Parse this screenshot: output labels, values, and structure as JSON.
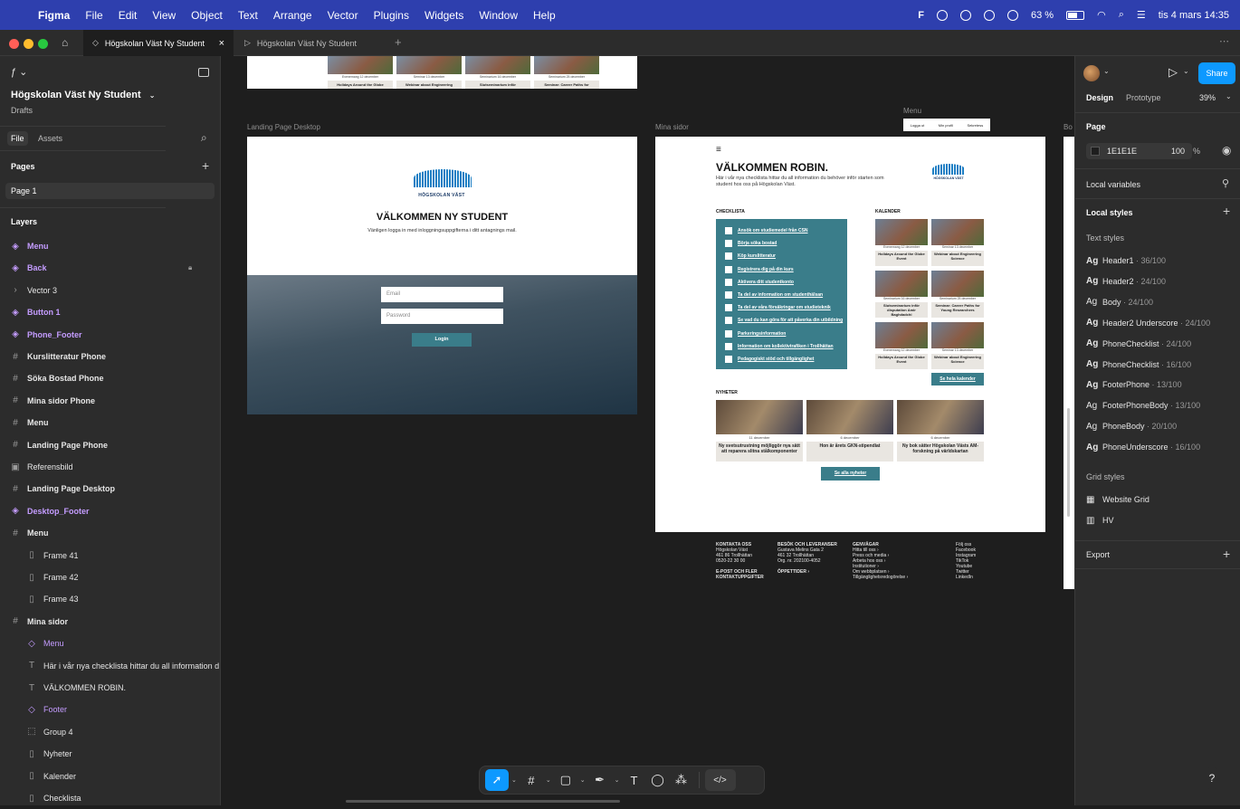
{
  "menubar": {
    "app": "Figma",
    "items": [
      "File",
      "Edit",
      "View",
      "Object",
      "Text",
      "Arrange",
      "Vector",
      "Plugins",
      "Widgets",
      "Window",
      "Help"
    ],
    "battery": "63 %",
    "datetime": "tis 4 mars 14:35"
  },
  "tabs": [
    {
      "label": "Högskolan Väst Ny Student"
    },
    {
      "label": "Högskolan Väst Ny Student"
    }
  ],
  "left": {
    "file_name": "Högskolan Väst Ny Student",
    "location": "Drafts",
    "tab_file": "File",
    "tab_assets": "Assets",
    "pages_title": "Pages",
    "page_current": "Page 1",
    "layers_title": "Layers",
    "layers": [
      {
        "label": "Menu",
        "type": "component"
      },
      {
        "label": "Back",
        "type": "component"
      },
      {
        "label": "Vector 3",
        "type": "vector"
      },
      {
        "label": "Button 1",
        "type": "component"
      },
      {
        "label": "Phone_Footer",
        "type": "component"
      },
      {
        "label": "Kurslitteratur Phone",
        "type": "frame"
      },
      {
        "label": "Söka Bostad Phone",
        "type": "frame"
      },
      {
        "label": "Mina sidor Phone",
        "type": "frame"
      },
      {
        "label": "Menu",
        "type": "frame"
      },
      {
        "label": "Landing Page Phone",
        "type": "frame"
      },
      {
        "label": "Referensbild",
        "type": "image"
      },
      {
        "label": "Landing Page Desktop",
        "type": "frame"
      },
      {
        "label": "Desktop_Footer",
        "type": "component"
      },
      {
        "label": "Menu",
        "type": "frame"
      },
      {
        "label": "Frame 41",
        "type": "child"
      },
      {
        "label": "Frame 42",
        "type": "child"
      },
      {
        "label": "Frame 43",
        "type": "child"
      },
      {
        "label": "Mina sidor",
        "type": "frame"
      },
      {
        "label": "Menu",
        "type": "instance"
      },
      {
        "label": "Här i vår nya checklista hittar du all information d",
        "type": "text"
      },
      {
        "label": "VÄLKOMMEN ROBIN.",
        "type": "text"
      },
      {
        "label": "Footer",
        "type": "instance"
      },
      {
        "label": "Group 4",
        "type": "group"
      },
      {
        "label": "Nyheter",
        "type": "child"
      },
      {
        "label": "Kalender",
        "type": "child"
      },
      {
        "label": "Checklista",
        "type": "child"
      }
    ]
  },
  "canvas": {
    "label_landing": "Landing Page Desktop",
    "label_mina": "Mina sidor",
    "label_menu": "Menu",
    "label_bo": "Bo",
    "top_cards": [
      "Evenemang 12 december",
      "Seminar 13 december",
      "Seminarium 16 december",
      "Seminarium 25 december"
    ],
    "top_card_titles": [
      "Holidays Around the Globe",
      "Webinar about Engineering",
      "Slutseminarium inför",
      "Seminar: Career Paths for"
    ],
    "landing": {
      "school": "HÖGSKOLAN VÄST",
      "title": "VÄLKOMMEN NY STUDENT",
      "subtitle": "Vänligen logga in med inloggningsuppgifterna i ditt antagnings mail.",
      "email_placeholder": "Email",
      "password_placeholder": "Password",
      "login": "Login"
    },
    "menu_pills": [
      "Logga ut",
      "Min profil",
      "Sekretess"
    ],
    "mina": {
      "hamburger": "≡",
      "title": "VÄLKOMMEN ROBIN.",
      "intro": "Här i vår nya checklista hittar du all information du behöver inför starten som student hos oss på Högskolan Väst.",
      "school": "HÖGSKOLAN VÄST",
      "checklist_title": "CHECKLISTA",
      "checklist": [
        "Ansök om studiemedel från CSN",
        "Börja söka bostad",
        "Köp kurslitteratur",
        "Registrera dig på din kurs",
        "Aktivera ditt studentkonto",
        "Ta del av information om studenthälsan",
        "Ta del av våra försäkringar om studieteknik",
        "Se vad du kan göra för att påverka din utbildning",
        "Parkeringsinformation",
        "Information om kollektivtrafiken i Trollhättan",
        "Pedagogiskt stöd och tillgänglighet"
      ],
      "kalender_title": "KALENDER",
      "kalender": [
        {
          "date": "Evenemang 12 december",
          "title": "Holidays Around the Globe Event"
        },
        {
          "date": "Seminar 13 december",
          "title": "Webinar about Engineering Science"
        },
        {
          "date": "Seminarium 16 december",
          "title": "Slutseminarium inför disputation Amir Baghdadchi"
        },
        {
          "date": "Seminarium 25 december",
          "title": "Seminar: Career Paths for Young Researchers"
        },
        {
          "date": "Evenemang 12 december",
          "title": "Holidays Around the Globe Event"
        },
        {
          "date": "Seminar 13 december",
          "title": "Webinar about Engineering Science"
        }
      ],
      "kalender_button": "Se hela kalender",
      "nyheter_title": "NYHETER",
      "nyheter": [
        {
          "date": "11 december",
          "title": "Ny svetsutrustning möjliggör nya sätt att reparera slitna stålkomponenter"
        },
        {
          "date": "6 december",
          "title": "Hon är årets GKN-stipendiat"
        },
        {
          "date": "6 december",
          "title": "Ny bok sätter Högskolan Västs AM-forskning på världskartan"
        }
      ],
      "nyheter_button": "Se alla nyheter"
    },
    "footer": {
      "col1_title": "KONTAKTA OSS",
      "col1_lines": [
        "Högskolan Väst",
        "461 86 Trollhättan",
        "0520-22 30 00"
      ],
      "col1b_title": "E-POST OCH FLER KONTAKTUPPGIFTER",
      "col2_title": "BESÖK OCH LEVERANSER",
      "col2_lines": [
        "Gustava Melins Gata 2",
        "461 32 Trollhättan",
        "Org. nr. 202100-4052"
      ],
      "col2b_title": "ÖPPETTIDER ›",
      "col3_title": "GENVÄGAR",
      "col3_lines": [
        "Hitta till oss ›",
        "Press och media ›",
        "Arbeta hos oss ›",
        "Institutioner ›",
        "Om webbplatsen ›",
        "Tillgänglighetsredogörelse ›"
      ],
      "col4_title": "Följ oss",
      "col4_lines": [
        "Facebook",
        "Instagram",
        "TikTok",
        "Youtube",
        "Twitter",
        "LinkedIn"
      ]
    }
  },
  "right": {
    "share": "Share",
    "tab_design": "Design",
    "tab_prototype": "Prototype",
    "zoom": "39%",
    "page_title": "Page",
    "page_color": "1E1E1E",
    "page_opacity": "100",
    "percent": "%",
    "local_variables": "Local variables",
    "local_styles": "Local styles",
    "text_styles": "Text styles",
    "styles": [
      {
        "name": "Header1",
        "meta": " · 36/100",
        "bold": true
      },
      {
        "name": "Header2",
        "meta": " · 24/100",
        "bold": true
      },
      {
        "name": "Body",
        "meta": " · 24/100",
        "bold": false
      },
      {
        "name": "Header2 Underscore",
        "meta": " · 24/100",
        "bold": true
      },
      {
        "name": "PhoneChecklist",
        "meta": " · 24/100",
        "bold": true
      },
      {
        "name": "PhoneChecklist",
        "meta": " · 16/100",
        "bold": true
      },
      {
        "name": "FooterPhone",
        "meta": " · 13/100",
        "bold": true
      },
      {
        "name": "FooterPhoneBody",
        "meta": " · 13/100",
        "bold": false
      },
      {
        "name": "PhoneBody",
        "meta": " · 20/100",
        "bold": false
      },
      {
        "name": "PhoneUnderscore",
        "meta": " · 16/100",
        "bold": true
      }
    ],
    "grid_styles": "Grid styles",
    "grids": [
      "Website Grid",
      "HV"
    ],
    "export": "Export"
  },
  "colors": {
    "accent": "#0d99ff",
    "teal": "#3a7d8a",
    "menubar": "#2e3fae",
    "component": "#c49cff"
  }
}
